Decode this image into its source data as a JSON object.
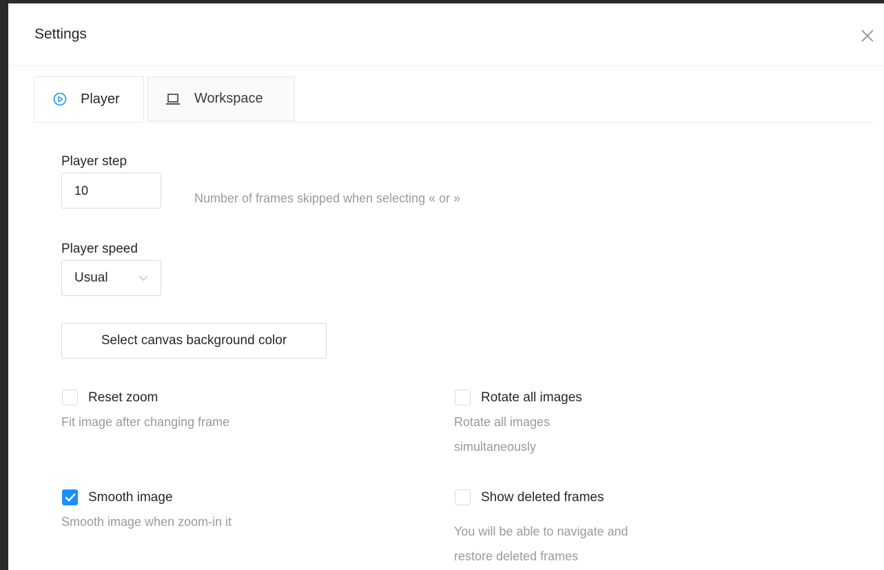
{
  "modal": {
    "title": "Settings"
  },
  "tabs": [
    {
      "label": "Player",
      "active": true,
      "icon": "play-circle-icon"
    },
    {
      "label": "Workspace",
      "active": false,
      "icon": "laptop-icon"
    }
  ],
  "player_step": {
    "label": "Player step",
    "value": "10",
    "hint": "Number of frames skipped when selecting « or »"
  },
  "player_speed": {
    "label": "Player speed",
    "selected": "Usual"
  },
  "canvas_bg_button": {
    "label": "Select canvas background color"
  },
  "options": {
    "reset_zoom": {
      "label": "Reset zoom",
      "checked": false,
      "hint": "Fit image after changing frame"
    },
    "rotate_all": {
      "label": "Rotate all images",
      "checked": false,
      "hint_line1": "Rotate all images",
      "hint_line2": "simultaneously"
    },
    "smooth_image": {
      "label": "Smooth image",
      "checked": true,
      "hint": "Smooth image when zoom-in it"
    },
    "show_deleted": {
      "label": "Show deleted frames",
      "checked": false,
      "hint_line1": "You will be able to navigate and",
      "hint_line2": "restore deleted frames"
    }
  },
  "colors": {
    "accent": "#1890ff",
    "border": "#d9d9d9",
    "hint_text": "#9a9a9a"
  }
}
